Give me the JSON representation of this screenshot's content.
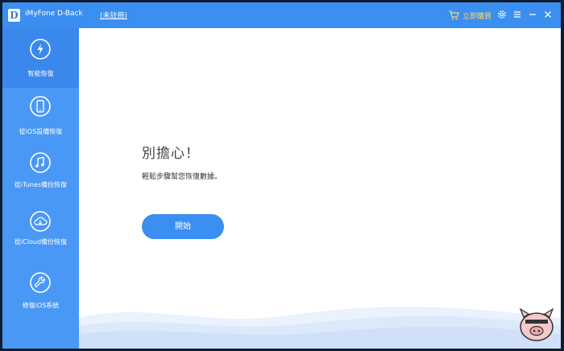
{
  "titlebar": {
    "logo_letter": "D",
    "app_title": "iMyFone D-Back",
    "register_link": "(未註冊)",
    "buy_label": "立即購買",
    "colors": {
      "bar": "#3a8ff0",
      "buy": "#ffd86a"
    }
  },
  "sidebar": {
    "items": [
      {
        "label": "智能恢復",
        "icon": "lightning-icon",
        "active": true
      },
      {
        "label": "從iOS設備恢復",
        "icon": "phone-icon",
        "active": false
      },
      {
        "label": "從iTunes備份恢復",
        "icon": "music-note-icon",
        "active": false
      },
      {
        "label": "從iCloud備份恢復",
        "icon": "cloud-download-icon",
        "active": false
      },
      {
        "label": "修復iOS系統",
        "icon": "wrench-icon",
        "active": false
      }
    ]
  },
  "main": {
    "heading": "別擔心！",
    "subtext": "輕鬆步驟幫您恢復數據。",
    "start_button": "開始"
  }
}
